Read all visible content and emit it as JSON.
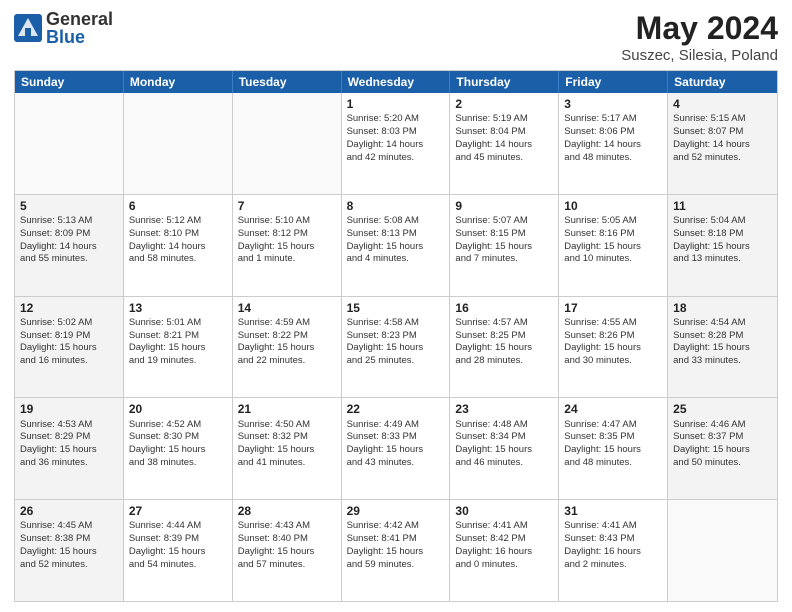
{
  "logo": {
    "general": "General",
    "blue": "Blue"
  },
  "title": {
    "month": "May 2024",
    "location": "Suszec, Silesia, Poland"
  },
  "header_days": [
    "Sunday",
    "Monday",
    "Tuesday",
    "Wednesday",
    "Thursday",
    "Friday",
    "Saturday"
  ],
  "rows": [
    [
      {
        "day": "",
        "text": "",
        "empty": true
      },
      {
        "day": "",
        "text": "",
        "empty": true
      },
      {
        "day": "",
        "text": "",
        "empty": true
      },
      {
        "day": "1",
        "text": "Sunrise: 5:20 AM\nSunset: 8:03 PM\nDaylight: 14 hours\nand 42 minutes.",
        "empty": false,
        "shaded": false
      },
      {
        "day": "2",
        "text": "Sunrise: 5:19 AM\nSunset: 8:04 PM\nDaylight: 14 hours\nand 45 minutes.",
        "empty": false,
        "shaded": false
      },
      {
        "day": "3",
        "text": "Sunrise: 5:17 AM\nSunset: 8:06 PM\nDaylight: 14 hours\nand 48 minutes.",
        "empty": false,
        "shaded": false
      },
      {
        "day": "4",
        "text": "Sunrise: 5:15 AM\nSunset: 8:07 PM\nDaylight: 14 hours\nand 52 minutes.",
        "empty": false,
        "shaded": true
      }
    ],
    [
      {
        "day": "5",
        "text": "Sunrise: 5:13 AM\nSunset: 8:09 PM\nDaylight: 14 hours\nand 55 minutes.",
        "empty": false,
        "shaded": true
      },
      {
        "day": "6",
        "text": "Sunrise: 5:12 AM\nSunset: 8:10 PM\nDaylight: 14 hours\nand 58 minutes.",
        "empty": false,
        "shaded": false
      },
      {
        "day": "7",
        "text": "Sunrise: 5:10 AM\nSunset: 8:12 PM\nDaylight: 15 hours\nand 1 minute.",
        "empty": false,
        "shaded": false
      },
      {
        "day": "8",
        "text": "Sunrise: 5:08 AM\nSunset: 8:13 PM\nDaylight: 15 hours\nand 4 minutes.",
        "empty": false,
        "shaded": false
      },
      {
        "day": "9",
        "text": "Sunrise: 5:07 AM\nSunset: 8:15 PM\nDaylight: 15 hours\nand 7 minutes.",
        "empty": false,
        "shaded": false
      },
      {
        "day": "10",
        "text": "Sunrise: 5:05 AM\nSunset: 8:16 PM\nDaylight: 15 hours\nand 10 minutes.",
        "empty": false,
        "shaded": false
      },
      {
        "day": "11",
        "text": "Sunrise: 5:04 AM\nSunset: 8:18 PM\nDaylight: 15 hours\nand 13 minutes.",
        "empty": false,
        "shaded": true
      }
    ],
    [
      {
        "day": "12",
        "text": "Sunrise: 5:02 AM\nSunset: 8:19 PM\nDaylight: 15 hours\nand 16 minutes.",
        "empty": false,
        "shaded": true
      },
      {
        "day": "13",
        "text": "Sunrise: 5:01 AM\nSunset: 8:21 PM\nDaylight: 15 hours\nand 19 minutes.",
        "empty": false,
        "shaded": false
      },
      {
        "day": "14",
        "text": "Sunrise: 4:59 AM\nSunset: 8:22 PM\nDaylight: 15 hours\nand 22 minutes.",
        "empty": false,
        "shaded": false
      },
      {
        "day": "15",
        "text": "Sunrise: 4:58 AM\nSunset: 8:23 PM\nDaylight: 15 hours\nand 25 minutes.",
        "empty": false,
        "shaded": false
      },
      {
        "day": "16",
        "text": "Sunrise: 4:57 AM\nSunset: 8:25 PM\nDaylight: 15 hours\nand 28 minutes.",
        "empty": false,
        "shaded": false
      },
      {
        "day": "17",
        "text": "Sunrise: 4:55 AM\nSunset: 8:26 PM\nDaylight: 15 hours\nand 30 minutes.",
        "empty": false,
        "shaded": false
      },
      {
        "day": "18",
        "text": "Sunrise: 4:54 AM\nSunset: 8:28 PM\nDaylight: 15 hours\nand 33 minutes.",
        "empty": false,
        "shaded": true
      }
    ],
    [
      {
        "day": "19",
        "text": "Sunrise: 4:53 AM\nSunset: 8:29 PM\nDaylight: 15 hours\nand 36 minutes.",
        "empty": false,
        "shaded": true
      },
      {
        "day": "20",
        "text": "Sunrise: 4:52 AM\nSunset: 8:30 PM\nDaylight: 15 hours\nand 38 minutes.",
        "empty": false,
        "shaded": false
      },
      {
        "day": "21",
        "text": "Sunrise: 4:50 AM\nSunset: 8:32 PM\nDaylight: 15 hours\nand 41 minutes.",
        "empty": false,
        "shaded": false
      },
      {
        "day": "22",
        "text": "Sunrise: 4:49 AM\nSunset: 8:33 PM\nDaylight: 15 hours\nand 43 minutes.",
        "empty": false,
        "shaded": false
      },
      {
        "day": "23",
        "text": "Sunrise: 4:48 AM\nSunset: 8:34 PM\nDaylight: 15 hours\nand 46 minutes.",
        "empty": false,
        "shaded": false
      },
      {
        "day": "24",
        "text": "Sunrise: 4:47 AM\nSunset: 8:35 PM\nDaylight: 15 hours\nand 48 minutes.",
        "empty": false,
        "shaded": false
      },
      {
        "day": "25",
        "text": "Sunrise: 4:46 AM\nSunset: 8:37 PM\nDaylight: 15 hours\nand 50 minutes.",
        "empty": false,
        "shaded": true
      }
    ],
    [
      {
        "day": "26",
        "text": "Sunrise: 4:45 AM\nSunset: 8:38 PM\nDaylight: 15 hours\nand 52 minutes.",
        "empty": false,
        "shaded": true
      },
      {
        "day": "27",
        "text": "Sunrise: 4:44 AM\nSunset: 8:39 PM\nDaylight: 15 hours\nand 54 minutes.",
        "empty": false,
        "shaded": false
      },
      {
        "day": "28",
        "text": "Sunrise: 4:43 AM\nSunset: 8:40 PM\nDaylight: 15 hours\nand 57 minutes.",
        "empty": false,
        "shaded": false
      },
      {
        "day": "29",
        "text": "Sunrise: 4:42 AM\nSunset: 8:41 PM\nDaylight: 15 hours\nand 59 minutes.",
        "empty": false,
        "shaded": false
      },
      {
        "day": "30",
        "text": "Sunrise: 4:41 AM\nSunset: 8:42 PM\nDaylight: 16 hours\nand 0 minutes.",
        "empty": false,
        "shaded": false
      },
      {
        "day": "31",
        "text": "Sunrise: 4:41 AM\nSunset: 8:43 PM\nDaylight: 16 hours\nand 2 minutes.",
        "empty": false,
        "shaded": false
      },
      {
        "day": "",
        "text": "",
        "empty": true,
        "shaded": true
      }
    ]
  ]
}
